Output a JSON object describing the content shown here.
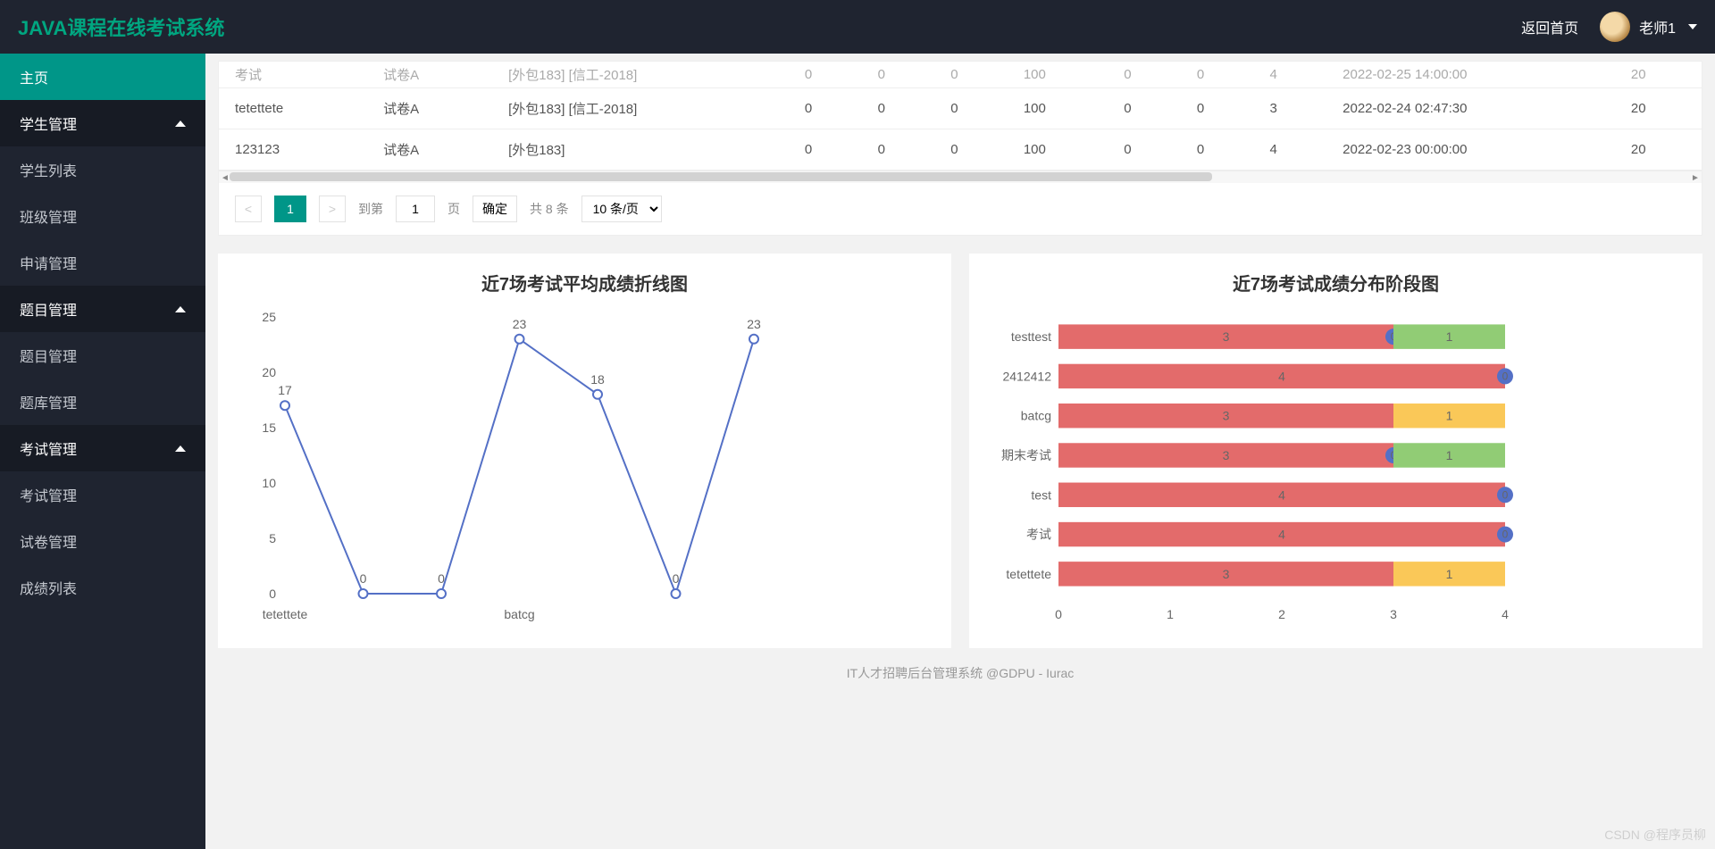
{
  "header": {
    "brand": "JAVA课程在线考试系统",
    "back_home": "返回首页",
    "username": "老师1"
  },
  "sidebar": {
    "items": [
      {
        "label": "主页",
        "type": "item",
        "active": true
      },
      {
        "label": "学生管理",
        "type": "group",
        "expanded": true
      },
      {
        "label": "学生列表",
        "type": "item"
      },
      {
        "label": "班级管理",
        "type": "item"
      },
      {
        "label": "申请管理",
        "type": "item"
      },
      {
        "label": "题目管理",
        "type": "group",
        "expanded": true
      },
      {
        "label": "题目管理",
        "type": "item"
      },
      {
        "label": "题库管理",
        "type": "item"
      },
      {
        "label": "考试管理",
        "type": "group",
        "expanded": true
      },
      {
        "label": "考试管理",
        "type": "item"
      },
      {
        "label": "试卷管理",
        "type": "item"
      },
      {
        "label": "成绩列表",
        "type": "item"
      }
    ]
  },
  "table": {
    "rows": [
      {
        "c0": "考试",
        "c1": "试卷A",
        "c2": "[外包183] [信工-2018]",
        "c3": "0",
        "c4": "0",
        "c5": "0",
        "c6": "100",
        "c7": "0",
        "c8": "0",
        "c9": "4",
        "c10": "2022-02-25 14:00:00",
        "c11": "20",
        "cut": true
      },
      {
        "c0": "tetettete",
        "c1": "试卷A",
        "c2": "[外包183] [信工-2018]",
        "c3": "0",
        "c4": "0",
        "c5": "0",
        "c6": "100",
        "c7": "0",
        "c8": "0",
        "c9": "3",
        "c10": "2022-02-24 02:47:30",
        "c11": "20"
      },
      {
        "c0": "123123",
        "c1": "试卷A",
        "c2": "[外包183]",
        "c3": "0",
        "c4": "0",
        "c5": "0",
        "c6": "100",
        "c7": "0",
        "c8": "0",
        "c9": "4",
        "c10": "2022-02-23 00:00:00",
        "c11": "20"
      }
    ]
  },
  "pager": {
    "current": "1",
    "goto_prefix": "到第",
    "page_input": "1",
    "goto_suffix": "页",
    "confirm": "确定",
    "total_text": "共 8 条",
    "per_page": "10 条/页"
  },
  "chart_data": [
    {
      "type": "line",
      "title": "近7场考试平均成绩折线图",
      "categories": [
        "tetettete",
        "",
        "",
        "batcg",
        "",
        "",
        ""
      ],
      "values": [
        17,
        0,
        0,
        23,
        18,
        0,
        23
      ],
      "ylim": [
        0,
        25
      ],
      "yticks": [
        0,
        5,
        10,
        15,
        20,
        25
      ],
      "xlabel": "",
      "ylabel": ""
    },
    {
      "type": "bar",
      "orientation": "horizontal",
      "stacked": true,
      "title": "近7场考试成绩分布阶段图",
      "categories": [
        "testtest",
        "2412412",
        "batcg",
        "期末考试",
        "test",
        "考试",
        "tetettete"
      ],
      "series": [
        {
          "name": "seg1",
          "color": "#e36b6b",
          "values": [
            3,
            4,
            3,
            3,
            4,
            4,
            3
          ]
        },
        {
          "name": "seg2",
          "color_per": [
            "#91cc75",
            null,
            "#fac858",
            "#91cc75",
            null,
            null,
            "#fac858"
          ],
          "values": [
            1,
            0,
            1,
            1,
            0,
            0,
            1
          ]
        }
      ],
      "bubble_labels": [
        0,
        0,
        null,
        0,
        0,
        0,
        null
      ],
      "xlim": [
        0,
        4
      ],
      "xticks": [
        0,
        1,
        2,
        3,
        4
      ],
      "xlabel": "",
      "ylabel": ""
    }
  ],
  "footer": "IT人才招聘后台管理系统 @GDPU - Iurac",
  "watermark": "CSDN @程序员柳"
}
